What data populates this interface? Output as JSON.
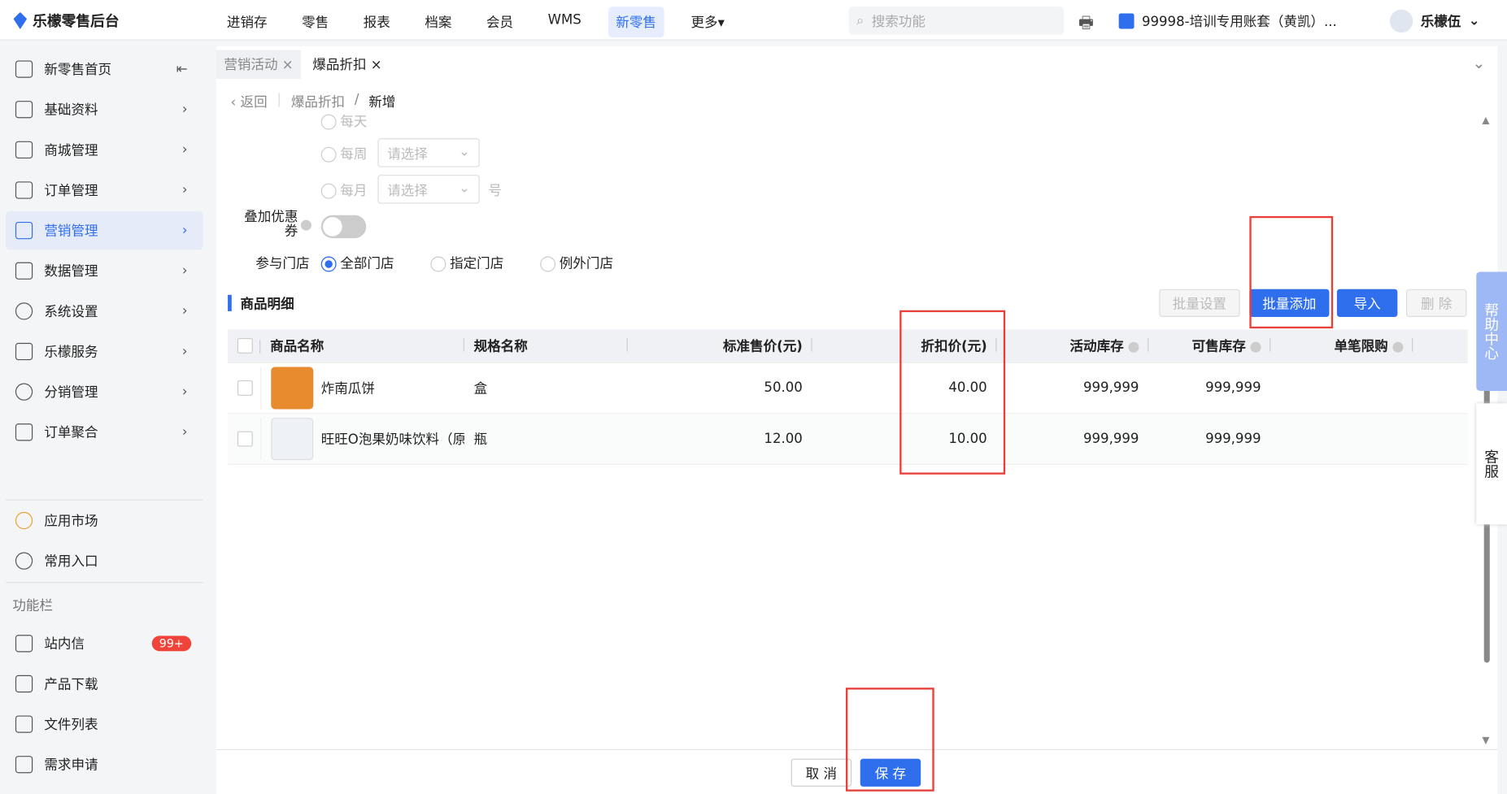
{
  "header": {
    "brand": "乐檬零售后台",
    "nav": [
      "进销存",
      "零售",
      "报表",
      "档案",
      "会员",
      "WMS",
      "新零售",
      "更多▾"
    ],
    "active_nav": "新零售",
    "search_placeholder": "搜索功能",
    "account": "99998-培训专用账套（黄凯）...",
    "user": "乐檬伍"
  },
  "sidebar": {
    "items": [
      {
        "label": "新零售首页",
        "icon": "home-icon"
      },
      {
        "label": "基础资料",
        "icon": "grid-icon"
      },
      {
        "label": "商城管理",
        "icon": "store-icon"
      },
      {
        "label": "订单管理",
        "icon": "order-icon"
      },
      {
        "label": "营销管理",
        "icon": "marketing-icon",
        "active": true
      },
      {
        "label": "数据管理",
        "icon": "chart-icon"
      },
      {
        "label": "系统设置",
        "icon": "gear-icon"
      },
      {
        "label": "乐檬服务",
        "icon": "service-icon"
      },
      {
        "label": "分销管理",
        "icon": "distribution-icon"
      },
      {
        "label": "订单聚合",
        "icon": "aggregate-icon"
      }
    ],
    "extra": [
      {
        "label": "应用市场"
      },
      {
        "label": "常用入口"
      }
    ],
    "section": "功能栏",
    "func": [
      {
        "label": "站内信",
        "badge": "99+"
      },
      {
        "label": "产品下载"
      },
      {
        "label": "文件列表"
      },
      {
        "label": "需求申请"
      }
    ]
  },
  "tabs": [
    {
      "label": "营销活动 ×"
    },
    {
      "label": "爆品折扣 ×",
      "active": true
    }
  ],
  "breadcrumb": {
    "back": "返回",
    "parent": "爆品折扣",
    "current": "新增"
  },
  "form": {
    "daily": "每天",
    "weekly": "每周",
    "monthly": "每月",
    "select_placeholder": "请选择",
    "day_suffix": "号",
    "coupon_label": "叠加优惠券",
    "coupon_enabled": false,
    "store_label": "参与门店",
    "store_options": [
      "全部门店",
      "指定门店",
      "例外门店"
    ],
    "store_selected": "全部门店"
  },
  "detail": {
    "title": "商品明细",
    "buttons": {
      "batch_set": "批量设置",
      "batch_add": "批量添加",
      "import": "导入",
      "delete": "删 除"
    }
  },
  "table": {
    "columns": [
      "商品名称",
      "规格名称",
      "标准售价(元)",
      "折扣价(元)",
      "活动库存",
      "可售库存",
      "单笔限购"
    ],
    "rows": [
      {
        "name": "炸南瓜饼",
        "spec": "盒",
        "price": "50.00",
        "discount": "40.00",
        "activity_stock": "999,999",
        "sale_stock": "999,999",
        "limit": ""
      },
      {
        "name": "旺旺O泡果奶味饮料（原",
        "spec": "瓶",
        "price": "12.00",
        "discount": "10.00",
        "activity_stock": "999,999",
        "sale_stock": "999,999",
        "limit": ""
      }
    ]
  },
  "footer": {
    "cancel": "取 消",
    "save": "保 存"
  },
  "float": {
    "help": "帮助中心",
    "service": "客服"
  },
  "colors": {
    "accent": "#2f6fee",
    "highlight": "#e8403a"
  }
}
